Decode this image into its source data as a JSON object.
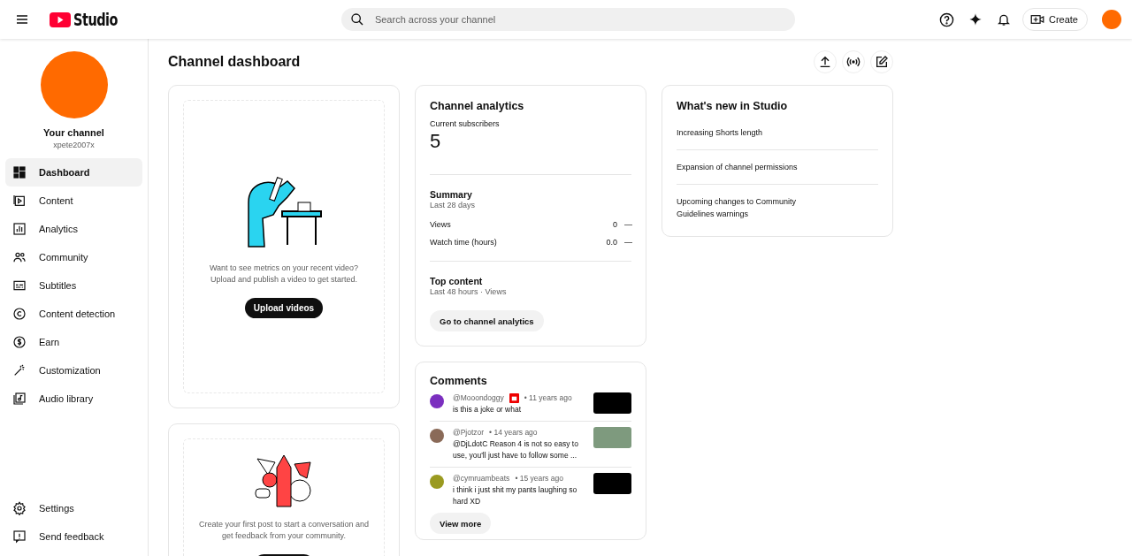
{
  "header": {
    "logo_text": "Studio",
    "search": {
      "placeholder": "Search across your channel"
    },
    "create_button": "Create"
  },
  "sidebar": {
    "channel_title": "Your channel",
    "channel_handle": "xpete2007x",
    "items": [
      {
        "label": "Dashboard",
        "selected": true
      },
      {
        "label": "Content",
        "selected": false
      },
      {
        "label": "Analytics",
        "selected": false
      },
      {
        "label": "Community",
        "selected": false
      },
      {
        "label": "Subtitles",
        "selected": false
      },
      {
        "label": "Content detection",
        "selected": false
      },
      {
        "label": "Earn",
        "selected": false
      },
      {
        "label": "Customization",
        "selected": false
      },
      {
        "label": "Audio library",
        "selected": false
      }
    ],
    "footer_items": [
      {
        "label": "Settings"
      },
      {
        "label": "Send feedback"
      }
    ]
  },
  "page_title": "Channel dashboard",
  "video_card": {
    "text": "Want to see metrics on your recent video? Upload and publish a video to get started.",
    "button": "Upload videos"
  },
  "post_card": {
    "text": "Create your first post to start a conversation and get feedback from your community."
  },
  "analytics": {
    "title": "Channel analytics",
    "subscribers_label": "Current subscribers",
    "subscribers": "5",
    "summary_title": "Summary",
    "summary_period": "Last 28 days",
    "metrics": [
      {
        "label": "Views",
        "value": "0",
        "trend": "—"
      },
      {
        "label": "Watch time (hours)",
        "value": "0.0",
        "trend": "—"
      }
    ],
    "top_content_title": "Top content",
    "top_content_period": "Last 48 hours · Views",
    "button": "Go to channel analytics"
  },
  "whats_new": {
    "title": "What's new in Studio",
    "items": [
      "Increasing Shorts length",
      "Expansion of channel permissions",
      "Upcoming changes to Community Guidelines warnings"
    ]
  },
  "comments": {
    "title": "Comments",
    "items": [
      {
        "author": "@Mooondoggy",
        "badge": true,
        "time": "• 11 years ago",
        "text": "is this a joke or what",
        "color": "#7b2fbf"
      },
      {
        "author": "@Pjotzor",
        "badge": false,
        "time": "• 14 years ago",
        "text": "@DjLdotC Reason 4 is not so easy to use, you'll just have to follow some ...",
        "color": "#8a6a58"
      },
      {
        "author": "@cymruambeats",
        "badge": false,
        "time": "• 15 years ago",
        "text": "i think i just shit my pants laughing so hard XD",
        "color": "#9a9a20"
      }
    ],
    "button": "View more"
  }
}
